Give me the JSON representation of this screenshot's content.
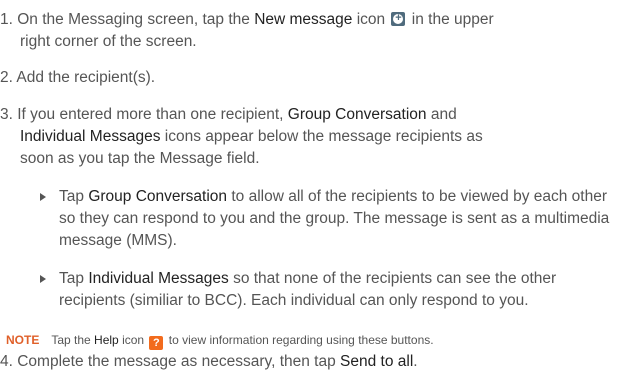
{
  "step1": {
    "a": "1. On the Messaging screen, tap the ",
    "b": "New message",
    "c": " icon ",
    "d": " in the upper",
    "e": "right corner of the screen."
  },
  "step2": {
    "a": "2. Add the recipient(s)."
  },
  "step3": {
    "a": "3. If you entered more than one recipient, ",
    "b": "Group Conversation",
    "c": " and",
    "d": "Individual Messages",
    "e": " icons appear below the message recipients as",
    "f": "soon as you tap the Message field."
  },
  "bullet1": {
    "a": "Tap ",
    "b": "Group Conversation",
    "c": " to allow all of the recipients to be viewed by each other so they can respond to you and the group. The message is sent as a multimedia message (MMS)."
  },
  "bullet2": {
    "a": "Tap ",
    "b": "Individual Messages",
    "c": " so that none of the recipients can see the other recipients (similiar to BCC). Each individual can only respond to you."
  },
  "note": {
    "label": "NOTE",
    "a": "Tap the ",
    "b": "Help",
    "c": " icon ",
    "help_glyph": "?",
    "d": " to view information regarding using these buttons."
  },
  "step4": {
    "a": "4. Complete the message as necessary, then tap ",
    "b": "Send to all",
    "c": "."
  },
  "icons": {
    "new_message": "plus-circle-icon",
    "help": "question-icon"
  },
  "colors": {
    "note": "#e0602a",
    "help_icon": "#f26b1d",
    "new_icon": "#4f6b7d"
  }
}
